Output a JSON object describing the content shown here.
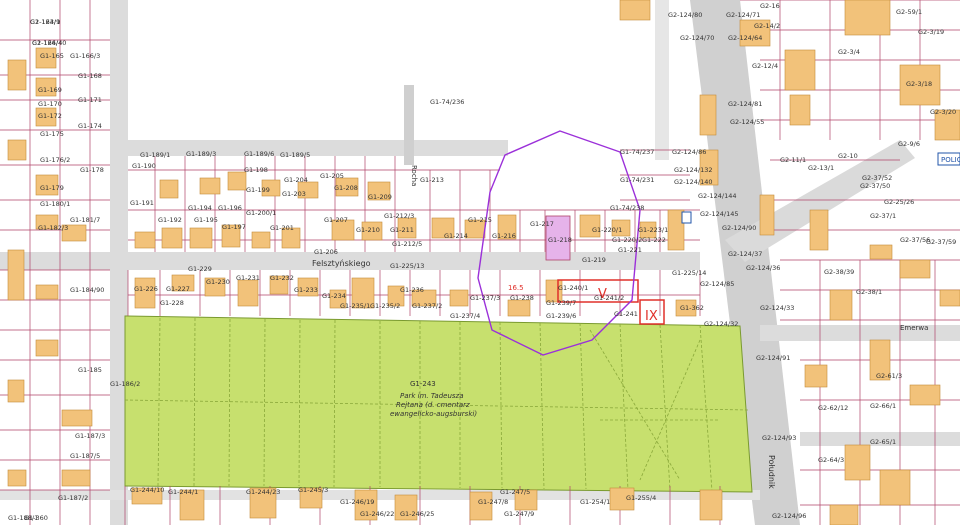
{
  "map": {
    "street_main": "Felsztyńskiego",
    "street_vertical": "Południk",
    "street_short": "Rocha",
    "street_east": "Emerwa",
    "police_label": "POLICJ",
    "park_parcel": "G1-243",
    "park_name_line1": "Park im. Tadeusza",
    "park_name_line2": "Rejtana (d. cmentarz",
    "park_name_line3": "ewangelicko-augsburski)",
    "zone_label_V": "V",
    "zone_label_IX": "IX",
    "value_label": "16.5",
    "colors": {
      "building": "#f2c27a",
      "parcel_line": "#b0446a",
      "park": "#c7e06e",
      "road": "#d8d8d8",
      "circle": "#9b30d9",
      "zone": "#e0302a",
      "highlight_parcel": "#e6b3ea"
    },
    "parcel_labels": [
      "G1-163/9",
      "G1-166/4",
      "G1-165",
      "G1-166/3",
      "G1-168",
      "G1-169",
      "G1-170",
      "G1-171",
      "G1-172",
      "G1-174",
      "G1-175",
      "G1-176/2",
      "G1-178",
      "G1-179",
      "G1-180/1",
      "G1-181/7",
      "G1-182/3",
      "G1-184/90",
      "G1-185",
      "G1-186/2",
      "G1-187/3",
      "G1-187/5",
      "G1-187/2",
      "G1-188/1",
      "G1-189/1",
      "G1-189/3",
      "G1-189/6",
      "G1-189/5",
      "G1-190",
      "G1-191",
      "G1-192",
      "G1-194",
      "G1-195",
      "G1-196",
      "G1-197",
      "G1-198",
      "G1-199",
      "G1-200/1",
      "G1-201",
      "G1-203",
      "G1-204",
      "G1-205",
      "G1-206",
      "G1-207",
      "G1-208",
      "G1-209",
      "G1-210",
      "G1-211",
      "G1-212/3",
      "G1-212/5",
      "G1-213",
      "G1-214",
      "G1-215",
      "G1-216",
      "G1-217",
      "G1-218",
      "G1-219",
      "G1-220/1",
      "G1-220/2",
      "G1-221",
      "G1-222",
      "G1-223/1",
      "G1-225/13",
      "G1-225/14",
      "G1-226",
      "G1-227",
      "G1-228",
      "G1-229",
      "G1-230",
      "G1-231",
      "G1-232",
      "G1-233",
      "G1-234",
      "G1-235/1",
      "G1-235/2",
      "G1-236",
      "G1-237/2",
      "G1-237/3",
      "G1-237/4",
      "G1-238",
      "G1-239/7",
      "G1-239/6",
      "G1-240/1",
      "G1-241/2",
      "G1-241",
      "G1-74/236",
      "G1-74/237",
      "G1-74/231",
      "G1-74/238",
      "G1-362",
      "G1-244/10",
      "G1-244/1",
      "G1-244/23",
      "G1-245/3",
      "G1-246/19",
      "G1-246/22",
      "G1-246/25",
      "G1-247/8",
      "G1-247/5",
      "G1-247/9",
      "G1-254/1",
      "G1-255/4",
      "G1-360",
      "G2-124/80",
      "G2-124/70",
      "G2-124/71",
      "G2-124/64",
      "G2-124/81",
      "G2-124/55",
      "G2-124/86",
      "G2-124/132",
      "G2-124/140",
      "G2-124/144",
      "G2-124/145",
      "G2-124/90",
      "G2-124/37",
      "G2-124/36",
      "G2-124/85",
      "G2-124/33",
      "G2-124/32",
      "G2-124/91",
      "G2-124/93",
      "G2-124/96",
      "G2-37/56",
      "G2-37/59",
      "G2-37/50",
      "G2-37/52",
      "G2-37/1",
      "G2-38/39",
      "G2-38/1",
      "G2-61/3",
      "G2-62/12",
      "G2-64/3",
      "G2-65/1",
      "G2-66/1",
      "G2-59/1",
      "G2-3/19",
      "G2-3/18",
      "G2-3/20",
      "G2-3/4",
      "G2-12/4",
      "G2-11/1",
      "G2-13/1",
      "G2-14/2",
      "G2-16",
      "G2-9/6",
      "G2-10",
      "G2-25/26",
      "G2-124/1",
      "G2-124/40"
    ]
  }
}
